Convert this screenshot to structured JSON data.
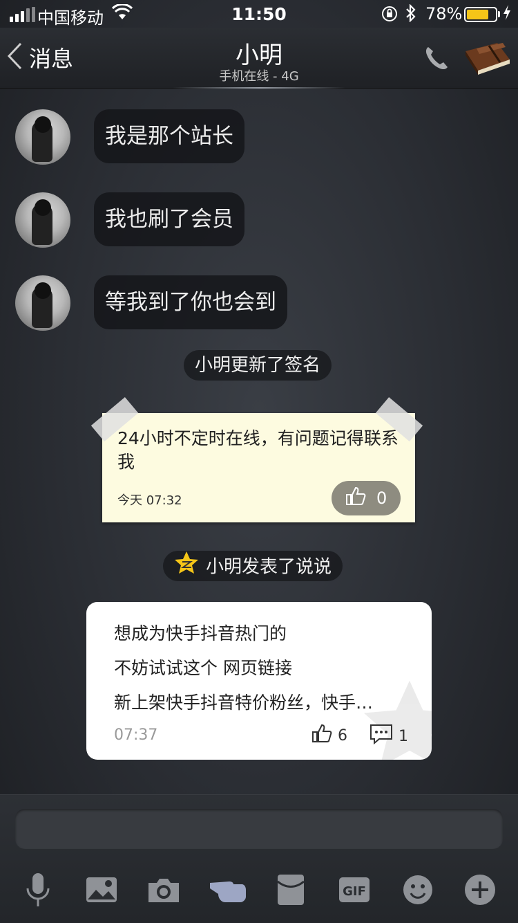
{
  "status_bar": {
    "carrier": "中国移动",
    "time": "11:50",
    "battery_percent": "78%",
    "battery_level": 0.78,
    "battery_color": "#f5c518"
  },
  "nav": {
    "back_label": "消息",
    "title": "小明",
    "subtitle": "手机在线 - 4G",
    "icons": [
      "back-chevron-icon",
      "phone-icon",
      "book-icon"
    ]
  },
  "messages": [
    {
      "text": "我是那个站长"
    },
    {
      "text": "我也刷了会员"
    },
    {
      "text": "等我到了你也会到"
    }
  ],
  "system_notice_signature": "小明更新了签名",
  "signature_note": {
    "text": "24小时不定时在线，有问题记得联系我",
    "time": "今天 07:32",
    "likes": "0"
  },
  "system_notice_post": "小明发表了说说",
  "post_card": {
    "lines": [
      "想成为快手抖音热门的",
      "不妨试试这个 网页链接",
      "新上架快手抖音特价粉丝，快手…"
    ],
    "time": "07:37",
    "likes": "6",
    "comments": "1"
  },
  "toolbar": {
    "icons": [
      "microphone-icon",
      "image-icon",
      "camera-icon",
      "poke-hand-icon",
      "red-packet-icon",
      "gif-icon",
      "emoji-icon",
      "plus-icon"
    ]
  }
}
